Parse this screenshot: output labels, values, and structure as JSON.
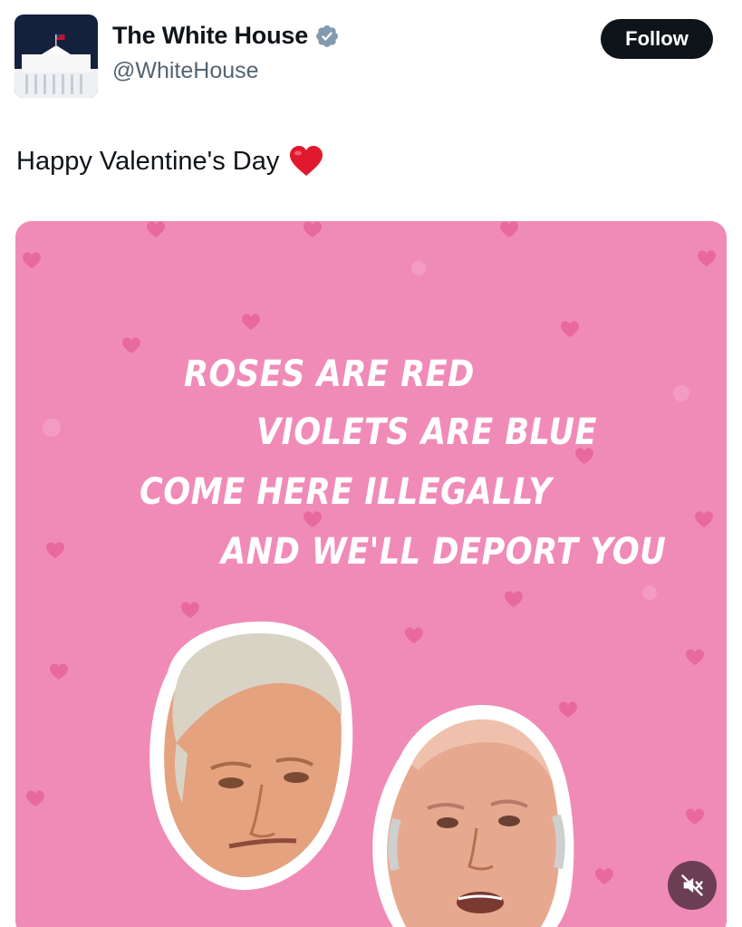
{
  "account": {
    "display_name": "The White House",
    "handle": "@WhiteHouse",
    "verified_icon": "verified-badge-icon",
    "follow_label": "Follow"
  },
  "tweet": {
    "text": "Happy Valentine's Day",
    "emoji": "heart-emoji-icon"
  },
  "media": {
    "type": "video",
    "poem": [
      "ROSES ARE RED",
      "VIOLETS ARE BLUE",
      "COME HERE ILLEGALLY",
      "AND WE'LL DEPORT YOU"
    ],
    "mute_icon": "speaker-muted-icon",
    "background_color": "#f08bb8"
  },
  "colors": {
    "follow_bg": "#0f1419",
    "handle": "#536471",
    "verified": "#829aab",
    "heart": "#e0192f"
  }
}
